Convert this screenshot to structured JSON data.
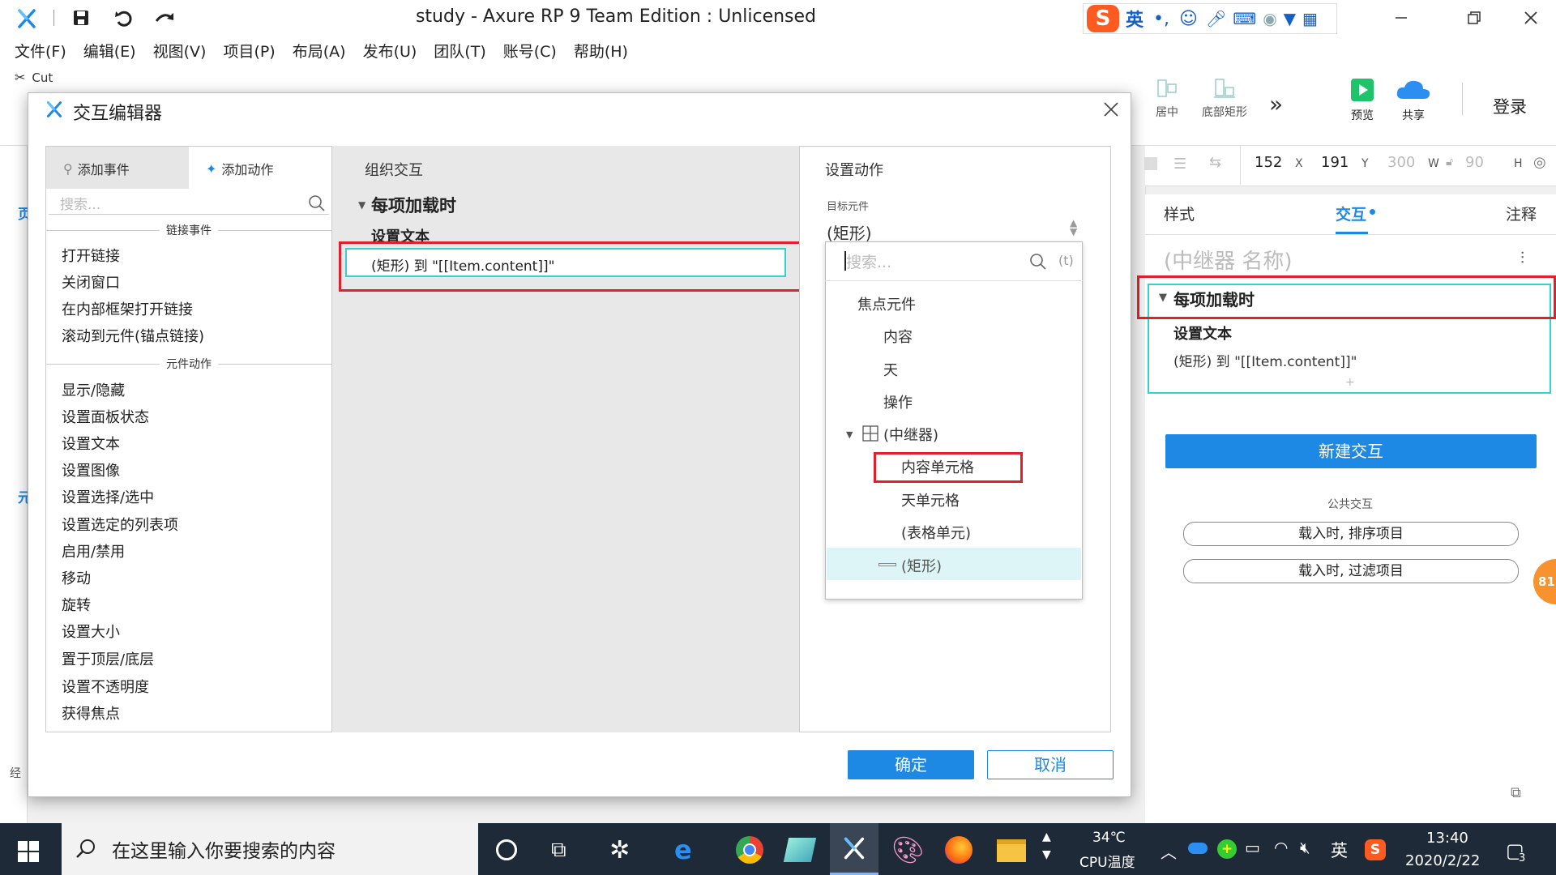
{
  "window": {
    "title": "study - Axure RP 9 Team Edition : Unlicensed"
  },
  "ime": {
    "lang": "英"
  },
  "menu": [
    "文件(F)",
    "编辑(E)",
    "视图(V)",
    "项目(P)",
    "布局(A)",
    "发布(U)",
    "团队(T)",
    "账号(C)",
    "帮助(H)"
  ],
  "ribbon": {
    "cut": "Cut",
    "center": "居中",
    "bottom": "底部矩形",
    "more": "»",
    "preview": "预览",
    "share": "共享",
    "login": "登录"
  },
  "props": {
    "x": "152",
    "x_lbl": "X",
    "y": "191",
    "y_lbl": "Y",
    "w": "300",
    "w_lbl": "W",
    "h": "90",
    "h_lbl": "H"
  },
  "right_panel": {
    "tabs": [
      "样式",
      "交互",
      "注释"
    ],
    "repeater_name": "(中继器 名称)",
    "event": "每项加载时",
    "action": "设置文本",
    "detail": "(矩形) 到 \"[[Item.content]]\"",
    "add": "+",
    "new_interaction": "新建交互",
    "common_title": "公共交互",
    "common": [
      "载入时, 排序项目",
      "载入时, 过滤项目"
    ],
    "badge": "81"
  },
  "left_edge": {
    "tab1": "页",
    "tab2": "元",
    "label": "经"
  },
  "dialog": {
    "title": "交互编辑器",
    "tabs": {
      "add_event": "添加事件",
      "add_action": "添加动作"
    },
    "search_placeholder": "搜索...",
    "section_link": "链接事件",
    "link_items": [
      "打开链接",
      "关闭窗口",
      "在内部框架打开链接",
      "滚动到元件(锚点链接)"
    ],
    "section_widget": "元件动作",
    "widget_items": [
      "显示/隐藏",
      "设置面板状态",
      "设置文本",
      "设置图像",
      "设置选择/选中",
      "设置选定的列表项",
      "启用/禁用",
      "移动",
      "旋转",
      "设置大小",
      "置于顶层/底层",
      "设置不透明度",
      "获得焦点"
    ],
    "organize": {
      "header": "组织交互",
      "event": "每项加载时",
      "action": "设置文本",
      "detail": "(矩形) 到 \"[[Item.content]]\""
    },
    "config": {
      "header": "设置动作",
      "target_label": "目标元件",
      "target_value": "(矩形)",
      "search_placeholder": "搜索...",
      "fx": "(t)",
      "tree": [
        "焦点元件",
        "内容",
        "天",
        "操作",
        "(中继器)",
        "内容单元格",
        "天单元格",
        "(表格单元)",
        "(矩形)"
      ]
    },
    "ok": "确定",
    "cancel": "取消"
  },
  "taskbar": {
    "search_placeholder": "在这里输入你要搜索的内容",
    "temp": "34℃",
    "temp_label": "CPU温度",
    "lang": "英",
    "time": "13:40",
    "date": "2020/2/22",
    "notif": "3"
  },
  "colors": {
    "accent": "#1e88e5",
    "highlight": "#e0202a",
    "teal": "#33d1d1",
    "taskbar": "#1f2a38"
  }
}
